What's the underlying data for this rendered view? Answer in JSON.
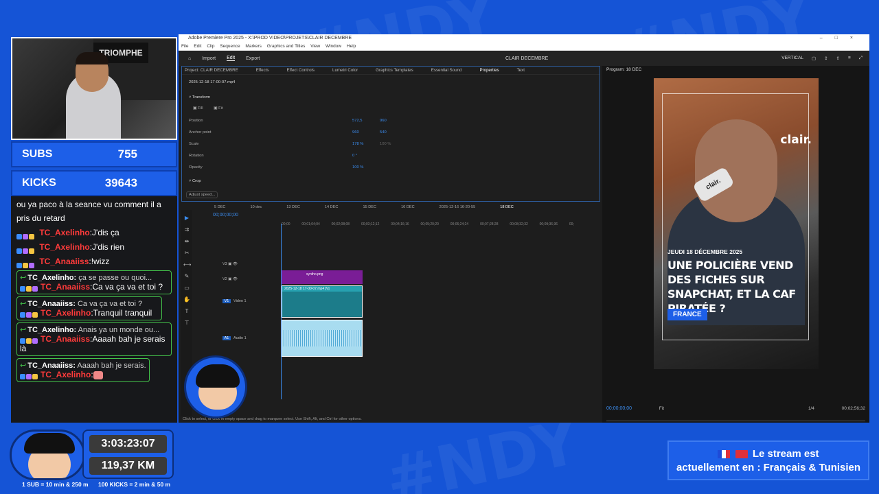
{
  "overlay": {
    "subs_label": "SUBS",
    "subs_value": "755",
    "kicks_label": "KICKS",
    "kicks_value": "39643",
    "timer": "3:03:23:07",
    "distance": "119,37 KM",
    "footer_sub": "1 SUB = 10 min & 250 m",
    "footer_kicks": "100 KICKS = 2 min & 50 m",
    "lang_line1": "Le stream est",
    "lang_line2": "actuellement en : Français & Tunisien",
    "cam_poster": "TRIOMPHE"
  },
  "chat": {
    "first_message": "ou ya paco à la seance vu comment il a pris du retard",
    "messages": [
      {
        "user": "TC_Axelinho",
        "text": ":J'dis ça"
      },
      {
        "user": "TC_Axelinho",
        "text": ":J'dis rien"
      },
      {
        "user": "TC_Anaaiiss",
        "text": ":!wizz"
      }
    ],
    "replies": [
      {
        "reply_user": "TC_Axelinho:",
        "reply_text": "ça se passe ou quoi...",
        "user": "TC_Anaaiiss",
        "text": ":Ca va ça va et toi ?"
      },
      {
        "reply_user": "TC_Anaaiiss:",
        "reply_text": "Ca va ça va et toi ?",
        "user": "TC_Axelinho",
        "text": ":Tranquil tranquil"
      },
      {
        "reply_user": "TC_Axelinho:",
        "reply_text": "Anais ya un monde ou...",
        "user": "TC_Anaaiiss",
        "text": ":Aaaah bah je serais là"
      },
      {
        "reply_user": "TC_Anaaiiss:",
        "reply_text": "Aaaah bah je serais...",
        "user": "TC_Axelinho",
        "text": ":"
      }
    ]
  },
  "premiere": {
    "window_title": "Adobe Premiere Pro 2025 - X:\\PROD VIDEO\\PROJETS\\CLAIR DECEMBRE",
    "menu": [
      "File",
      "Edit",
      "Clip",
      "Sequence",
      "Markers",
      "Graphics and Titles",
      "View",
      "Window",
      "Help"
    ],
    "header_tabs": [
      "Import",
      "Edit",
      "Export"
    ],
    "active_header_tab": "Edit",
    "project_center": "CLAIR DECEMBRE",
    "header_right": "VERTICAL",
    "panel_tabs": [
      "Project: CLAIR DECEMBRE",
      "Effects",
      "Effect Controls",
      "Lumetri Color",
      "Graphics Templates",
      "Essential Sound",
      "Properties",
      "Text"
    ],
    "clip_name": "2025-12-18 17-00-07.mp4",
    "transform_label": "Transform",
    "fill": "Fill",
    "fit": "Fit",
    "position_label": "Position",
    "position_x": "572,5",
    "position_y": "960",
    "anchor_label": "Anchor point",
    "anchor_x": "960",
    "anchor_y": "540",
    "scale_label": "Scale",
    "scale_value": "178 %",
    "scale_link": "100 %",
    "rotation_label": "Rotation",
    "rotation_value": "0 °",
    "opacity_label": "Opacity",
    "opacity_value": "100 %",
    "crop_label": "Crop",
    "adjust_speed": "Adjust speed...",
    "program_label": "Program: 18 DEC",
    "seq_tabs": [
      "5 DEC",
      "10 dec",
      "13 DEC",
      "14 DEC",
      "15 DEC",
      "16 DEC",
      "2025-12-16 16-20-55",
      "18 DEC"
    ],
    "timeline_timecode": "00;00;00;00",
    "ruler": [
      "00;00",
      "00;01;04;04",
      "00;02;08;08",
      "00;03;12;12",
      "00;04;16;16",
      "00;05;20;20",
      "00;06;24;24",
      "00;07;28;28",
      "00;08;32;32",
      "00;09;36;36",
      "00;"
    ],
    "track_v3": "V3",
    "track_v2": "V2",
    "track_v1": "V1",
    "track_v1_name": "Video 1",
    "track_a1": "A1",
    "track_a1_name": "Audio 1",
    "clip_v2": "syntho.png",
    "clip_v1": "2025-12-18 17-00-07.mp4 [V]",
    "monitor_timecode": "00;00;00;00",
    "monitor_fit": "Fit",
    "monitor_quality": "1/4",
    "monitor_duration": "00;02;56;32",
    "status_bar": "Click to select, or click in empty space and drag to marquee select. Use Shift, Alt, and Ctrl for other options."
  },
  "video_frame": {
    "brand": "clair.",
    "mic_text": "clair.",
    "date": "JEUDI 18 DÉCEMBRE 2025",
    "headline": "UNE POLICIÈRE VEND DES FICHES SUR SNAPCHAT, ET LA CAF PIRATÉE ?",
    "tag": "FRANCE"
  }
}
